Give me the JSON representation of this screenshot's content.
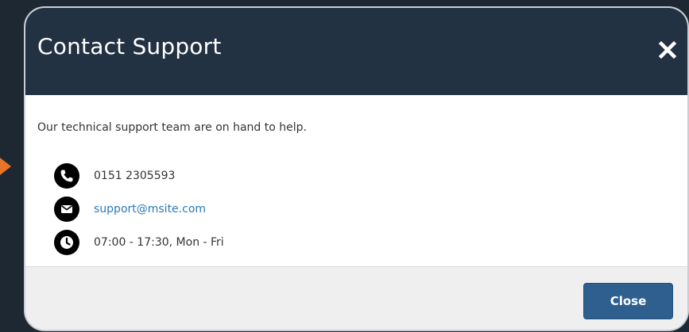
{
  "modal": {
    "title": "Contact Support",
    "intro": "Our technical support team are on hand to help.",
    "contacts": [
      {
        "icon": "phone-icon",
        "text": "0151 2305593"
      },
      {
        "icon": "envelope-icon",
        "text": "support@msite.com"
      },
      {
        "icon": "clock-icon",
        "text": "07:00 - 17:30, Mon - Fri"
      }
    ],
    "close_label": "Close"
  },
  "colors": {
    "header_bg": "#233243",
    "link": "#2a7ab8",
    "button_bg": "#2e5f8f",
    "arrow": "#e8742a"
  }
}
